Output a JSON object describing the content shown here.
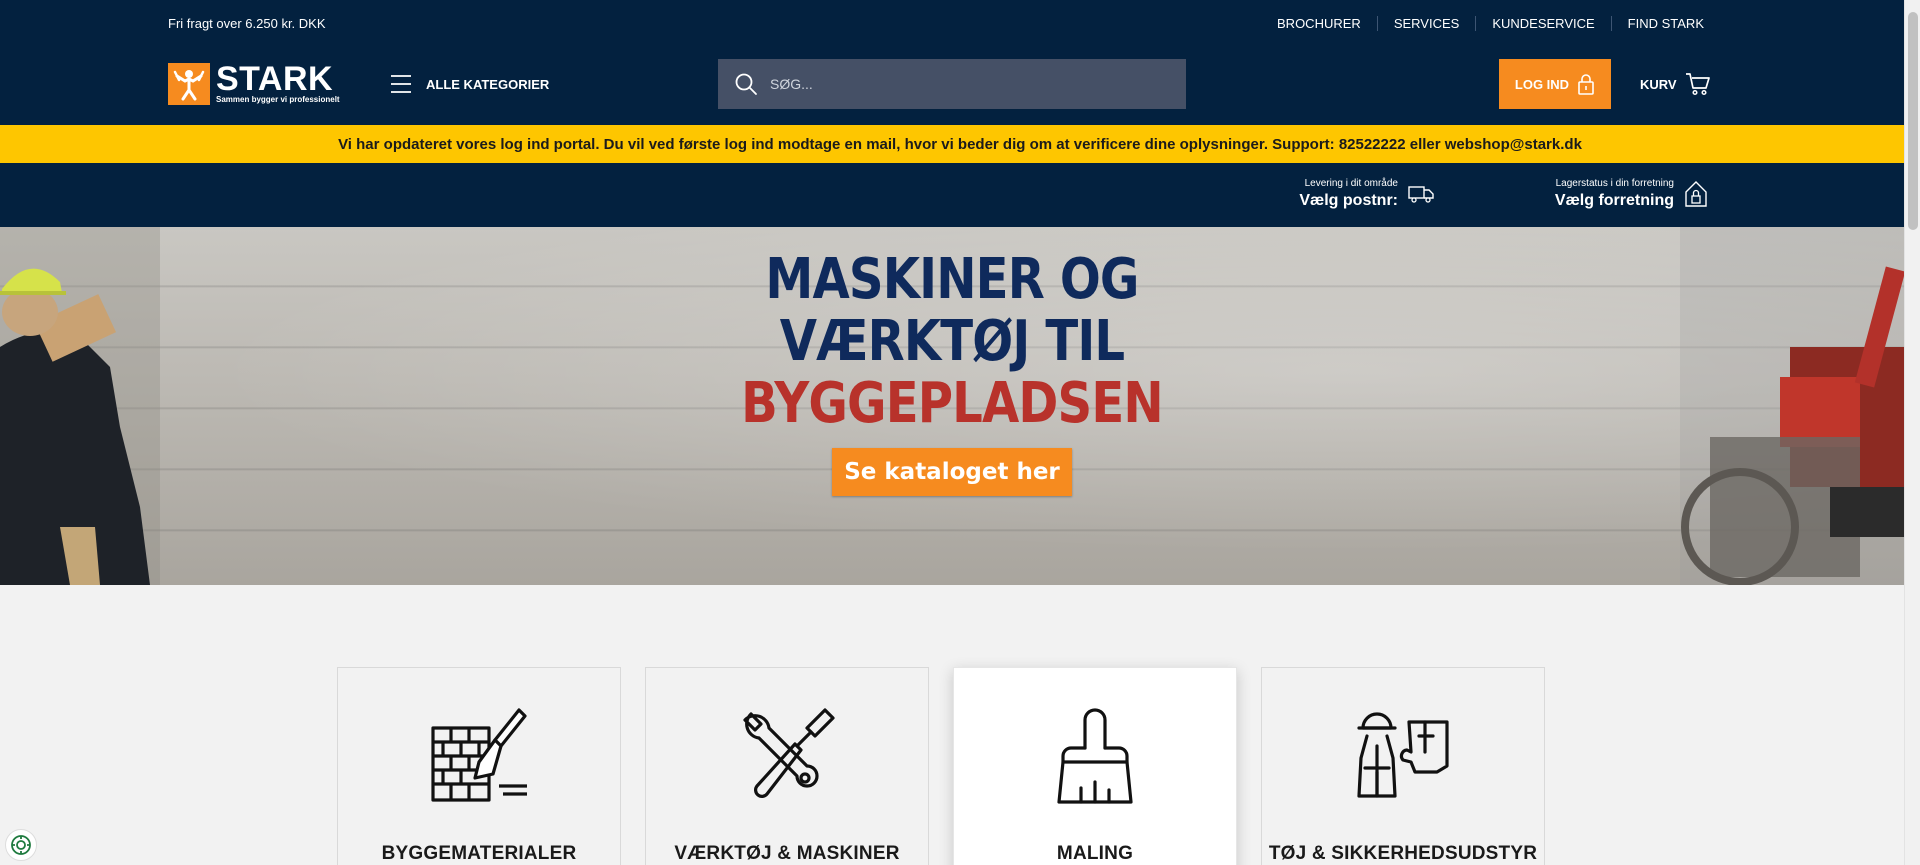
{
  "header": {
    "topbar": {
      "shipping_text": "Fri fragt over 6.250 kr. DKK",
      "links": [
        "BROCHURER",
        "SERVICES",
        "KUNDESERVICE",
        "FIND STARK"
      ]
    },
    "logo": {
      "word": "STARK",
      "tagline": "Sammen bygger vi professionelt"
    },
    "menu_label": "ALLE KATEGORIER",
    "search_placeholder": "SØG...",
    "login_label": "LOG IND",
    "cart_label": "KURV"
  },
  "notice": "Vi har opdateret vores log ind portal. Du vil ved første log ind modtage en mail, hvor vi beder dig om at verificere dine oplysninger. Support: 82522222 eller webshop@stark.dk",
  "subbar": {
    "delivery": {
      "small": "Levering i dit område",
      "big": "Vælg postnr:"
    },
    "store": {
      "small": "Lagerstatus i din forretning",
      "big": "Vælg forretning"
    }
  },
  "hero": {
    "line1": "MASKINER OG",
    "line2": "VÆRKTØJ TIL",
    "line3": "BYGGEPLADSEN",
    "cta": "Se kataloget her"
  },
  "categories": [
    {
      "name": "BYGGEMATERIALER",
      "icon": "bricks-trowel-icon"
    },
    {
      "name": "VÆRKTØJ & MASKINER",
      "icon": "wrench-screwdriver-icon"
    },
    {
      "name": "MALING",
      "icon": "paintbrush-icon"
    },
    {
      "name": "TØJ & SIKKERHEDSUDSTYR",
      "icon": "helmet-vest-glove-icon"
    }
  ],
  "colors": {
    "navy": "#03213f",
    "orange": "#f68b1f",
    "yellow": "#fec600",
    "hero_blue": "#0f2a5c",
    "hero_red": "#b8322b"
  }
}
